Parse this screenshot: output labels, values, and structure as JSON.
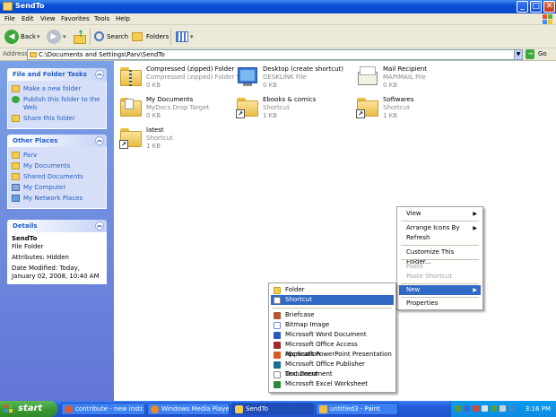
{
  "window": {
    "title": "SendTo",
    "controls": [
      "_",
      "□",
      "✕"
    ]
  },
  "menubar": [
    "File",
    "Edit",
    "View",
    "Favorites",
    "Tools",
    "Help"
  ],
  "toolbar": {
    "back": "Back",
    "search": "Search",
    "folders": "Folders"
  },
  "address": {
    "label": "Address",
    "value": "C:\\Documents and Settings\\Parv\\SendTo",
    "go": "Go"
  },
  "tasks_panel": {
    "title": "File and Folder Tasks",
    "items": [
      "Make a new folder",
      "Publish this folder to the Web",
      "Share this folder"
    ]
  },
  "places_panel": {
    "title": "Other Places",
    "items": [
      "Parv",
      "My Documents",
      "Shared Documents",
      "My Computer",
      "My Network Places"
    ]
  },
  "details_panel": {
    "title": "Details",
    "name": "SendTo",
    "type": "File Folder",
    "attributes": "Attributes: Hidden",
    "modified": "Date Modified: Today, January 02, 2008, 10:40 AM"
  },
  "files": [
    {
      "name": "Compressed (zipped) Folder",
      "sub": "Compressed (zipped) Folder S...",
      "size": "0 KB",
      "icon": "zip-folder-icon"
    },
    {
      "name": "Desktop (create shortcut)",
      "sub": "DESKLINK File",
      "size": "0 KB",
      "icon": "desktop-icon"
    },
    {
      "name": "Mail Recipient",
      "sub": "MAPIMAIL File",
      "size": "0 KB",
      "icon": "mail-icon"
    },
    {
      "name": "My Documents",
      "sub": "MyDocs Drop Target",
      "size": "0 KB",
      "icon": "mydocs-icon"
    },
    {
      "name": "Ebooks & comics",
      "sub": "Shortcut",
      "size": "1 KB",
      "icon": "folder-shortcut-icon"
    },
    {
      "name": "Softwares",
      "sub": "Shortcut",
      "size": "1 KB",
      "icon": "folder-shortcut-icon"
    },
    {
      "name": "latest",
      "sub": "Shortcut",
      "size": "1 KB",
      "icon": "folder-shortcut-icon"
    }
  ],
  "context_menu": {
    "items": [
      "View",
      "Arrange Icons By",
      "Refresh",
      "Customize This Folder...",
      "Paste",
      "Paste Shortcut",
      "New",
      "Properties"
    ]
  },
  "new_submenu": {
    "items": [
      "Folder",
      "Shortcut",
      "Briefcase",
      "Bitmap Image",
      "Microsoft Word Document",
      "Microsoft Office Access Application",
      "Microsoft PowerPoint Presentation",
      "Microsoft Office Publisher Document",
      "Text Document",
      "Microsoft Excel Worksheet"
    ]
  },
  "taskbar": {
    "start": "start",
    "buttons": [
      "contribute - new instr...",
      "Windows Media Player",
      "SendTo",
      "untitled3 - Paint"
    ],
    "clock": "3:16 PM"
  },
  "colors": {
    "title_blue": "#0a4fd6",
    "panel_blue": "#215dc6",
    "highlight": "#316ac5",
    "start_green": "#3c9a35"
  }
}
